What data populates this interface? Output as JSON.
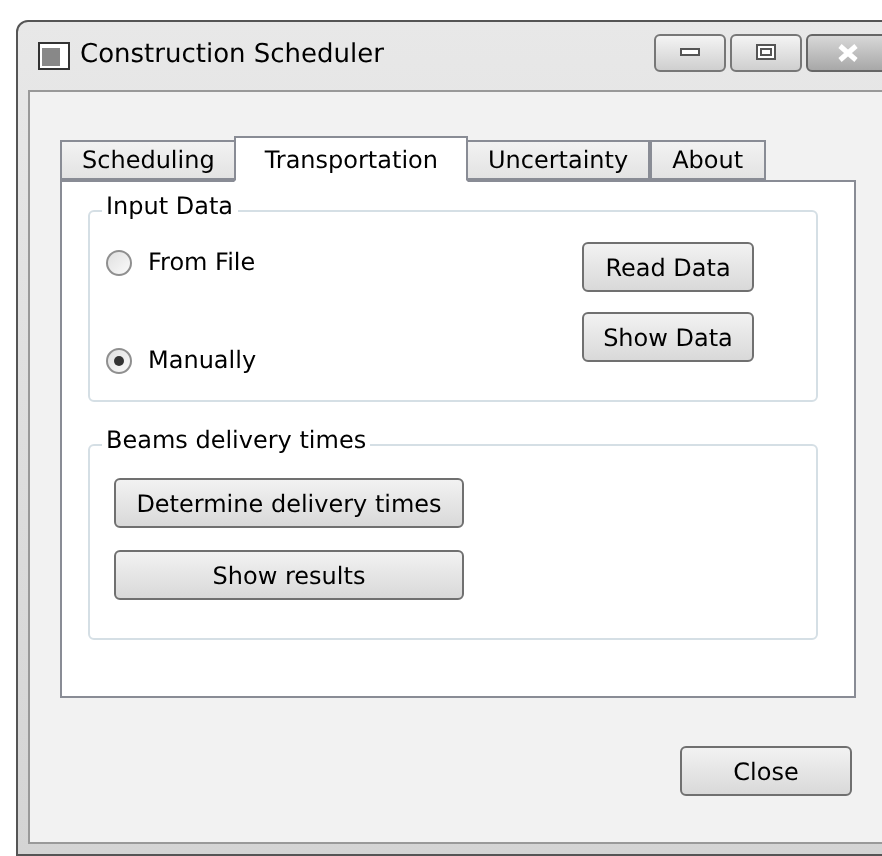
{
  "window": {
    "title": "Construction Scheduler"
  },
  "tabs": [
    {
      "label": "Scheduling",
      "selected": false
    },
    {
      "label": "Transportation",
      "selected": true
    },
    {
      "label": "Uncertainty",
      "selected": false
    },
    {
      "label": "About",
      "selected": false
    }
  ],
  "input_group": {
    "title": "Input Data",
    "options": [
      {
        "label": "From File",
        "selected": false
      },
      {
        "label": "Manually",
        "selected": true
      }
    ],
    "buttons": [
      "Read Data",
      "Show Data"
    ]
  },
  "delivery_group": {
    "title": "Beams delivery times",
    "buttons": [
      "Determine delivery times",
      "Show results"
    ]
  },
  "footer_buttons": [
    "Close"
  ]
}
